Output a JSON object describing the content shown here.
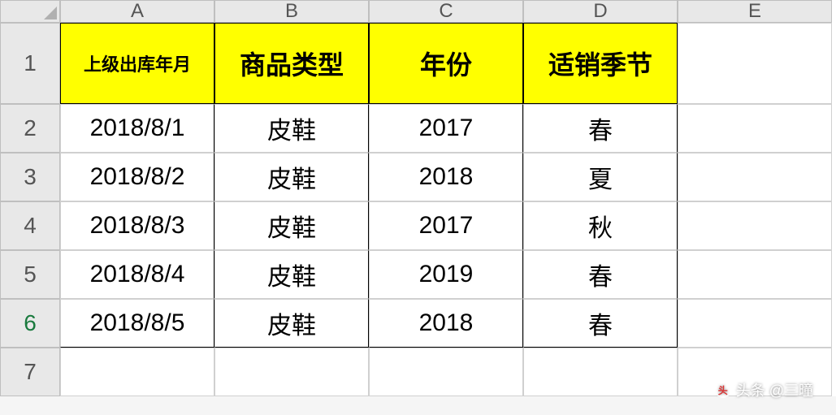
{
  "columns": [
    "A",
    "B",
    "C",
    "D",
    "E"
  ],
  "rows": [
    "1",
    "2",
    "3",
    "4",
    "5",
    "6",
    "7"
  ],
  "selected_row": "6",
  "headers": {
    "A": "上级出库年月",
    "B": "商品类型",
    "C": "年份",
    "D": "适销季节"
  },
  "data": [
    {
      "A": "2018/8/1",
      "B": "皮鞋",
      "C": "2017",
      "D": "春"
    },
    {
      "A": "2018/8/2",
      "B": "皮鞋",
      "C": "2018",
      "D": "夏"
    },
    {
      "A": "2018/8/3",
      "B": "皮鞋",
      "C": "2017",
      "D": "秋"
    },
    {
      "A": "2018/8/4",
      "B": "皮鞋",
      "C": "2019",
      "D": "春"
    },
    {
      "A": "2018/8/5",
      "B": "皮鞋",
      "C": "2018",
      "D": "春"
    }
  ],
  "watermark": {
    "text": "头条 @三曈"
  }
}
